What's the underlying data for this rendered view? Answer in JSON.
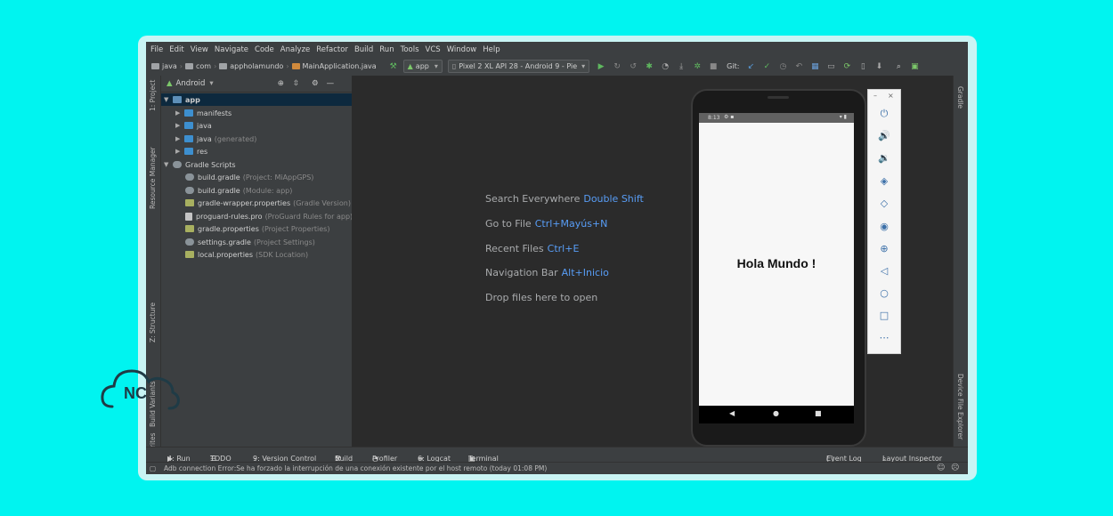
{
  "menu": [
    "File",
    "Edit",
    "View",
    "Navigate",
    "Code",
    "Analyze",
    "Refactor",
    "Build",
    "Run",
    "Tools",
    "VCS",
    "Window",
    "Help"
  ],
  "breadcrumb": [
    "java",
    "com",
    "appholamundo",
    "MainApplication.java"
  ],
  "toolbar": {
    "run_config": "app",
    "device": "Pixel 2 XL API 28 - Android 9 - Pie",
    "git_label": "Git:"
  },
  "left_tabs": {
    "project": "1: Project",
    "resource_manager": "Resource Manager",
    "structure": "Z: Structure",
    "build_variants": "Build Variants",
    "favorites": "2: Favorites"
  },
  "right_tabs": {
    "gradle": "Gradle",
    "device_file_explorer": "Device File Explorer"
  },
  "project_panel": {
    "view_selector": "Android",
    "tree": [
      {
        "label": "app",
        "depth": 0,
        "expanded": true,
        "icon": "folder-module-icon"
      },
      {
        "label": "manifests",
        "depth": 1,
        "expanded": false,
        "icon": "folder-icon"
      },
      {
        "label": "java",
        "depth": 1,
        "expanded": false,
        "icon": "folder-icon"
      },
      {
        "label": "java",
        "extra": "(generated)",
        "depth": 1,
        "expanded": false,
        "icon": "folder-generated-icon"
      },
      {
        "label": "res",
        "depth": 1,
        "expanded": false,
        "icon": "folder-icon"
      },
      {
        "label": "Gradle Scripts",
        "depth": 0,
        "expanded": true,
        "icon": "gradle-icon"
      },
      {
        "label": "build.gradle",
        "extra": "(Project: MiAppGPS)",
        "depth": 1,
        "icon": "gradle-icon"
      },
      {
        "label": "build.gradle",
        "extra": "(Module: app)",
        "depth": 1,
        "icon": "gradle-icon"
      },
      {
        "label": "gradle-wrapper.properties",
        "extra": "(Gradle Version)",
        "depth": 1,
        "icon": "properties-icon"
      },
      {
        "label": "proguard-rules.pro",
        "extra": "(ProGuard Rules for app)",
        "depth": 1,
        "icon": "file-icon"
      },
      {
        "label": "gradle.properties",
        "extra": "(Project Properties)",
        "depth": 1,
        "icon": "properties-icon"
      },
      {
        "label": "settings.gradle",
        "extra": "(Project Settings)",
        "depth": 1,
        "icon": "gradle-icon"
      },
      {
        "label": "local.properties",
        "extra": "(SDK Location)",
        "depth": 1,
        "icon": "properties-icon"
      }
    ]
  },
  "editor_hints": [
    {
      "text": "Search Everywhere",
      "key": "Double Shift"
    },
    {
      "text": "Go to File",
      "key": "Ctrl+Mayús+N"
    },
    {
      "text": "Recent Files",
      "key": "Ctrl+E"
    },
    {
      "text": "Navigation Bar",
      "key": "Alt+Inicio"
    },
    {
      "text": "Drop files here to open",
      "key": ""
    }
  ],
  "phone": {
    "time": "8:13",
    "app_text": "Hola Mundo !"
  },
  "emulator_controls": [
    "power-icon",
    "volume-up-icon",
    "volume-down-icon",
    "rotate-left-icon",
    "rotate-right-icon",
    "camera-icon",
    "zoom-icon",
    "back-icon",
    "home-icon",
    "overview-icon",
    "more-icon"
  ],
  "bottom_tabs": [
    {
      "label": "4: Run",
      "icon": "run-icon"
    },
    {
      "label": "TODO",
      "icon": "todo-icon"
    },
    {
      "label": "9: Version Control",
      "icon": "vcs-icon"
    },
    {
      "label": "Build",
      "icon": "build-icon"
    },
    {
      "label": "Profiler",
      "icon": "profiler-icon"
    },
    {
      "label": "6: Logcat",
      "icon": "logcat-icon"
    },
    {
      "label": "Terminal",
      "icon": "terminal-icon"
    }
  ],
  "bottom_right_tabs": [
    {
      "label": "Event Log",
      "icon": "event-log-icon"
    },
    {
      "label": "Layout Inspector",
      "icon": "layout-inspector-icon"
    }
  ],
  "status_message": "Adb connection Error:Se ha forzado la interrupción de una conexión existente por el host remoto (today 01:08 PM)",
  "logo_text": "NC"
}
